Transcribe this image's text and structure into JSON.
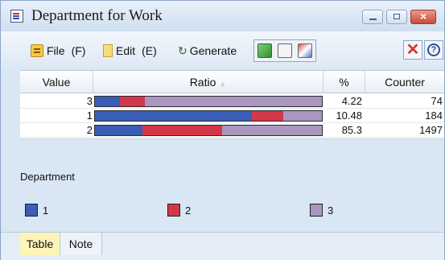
{
  "window": {
    "title": "Department for Work"
  },
  "toolbar": {
    "file_label": "File",
    "file_accel": "(F)",
    "edit_label": "Edit",
    "edit_accel": "(E)",
    "generate_label": "Generate"
  },
  "table": {
    "columns": [
      "Value",
      "Ratio",
      "%",
      "Counter"
    ],
    "rows": [
      {
        "value": "3",
        "percent": "4.22",
        "counter": "74",
        "segments": [
          {
            "color": "#3a5eb7",
            "share": 0.11
          },
          {
            "color": "#d2384a",
            "share": 0.11
          },
          {
            "color": "#a997bf",
            "share": 0.78
          }
        ]
      },
      {
        "value": "1",
        "percent": "10.48",
        "counter": "184",
        "segments": [
          {
            "color": "#3a5eb7",
            "share": 0.69
          },
          {
            "color": "#d2384a",
            "share": 0.14
          },
          {
            "color": "#a997bf",
            "share": 0.17
          }
        ]
      },
      {
        "value": "2",
        "percent": "85.3",
        "counter": "1497",
        "segments": [
          {
            "color": "#3a5eb7",
            "share": 0.21
          },
          {
            "color": "#d2384a",
            "share": 0.35
          },
          {
            "color": "#a997bf",
            "share": 0.44
          }
        ]
      }
    ]
  },
  "legend": {
    "title": "Department",
    "items": [
      {
        "label": "1",
        "color": "#3a5eb7"
      },
      {
        "label": "2",
        "color": "#d2384a"
      },
      {
        "label": "3",
        "color": "#a997bf"
      }
    ]
  },
  "tabs": [
    {
      "label": "Table",
      "active": true
    },
    {
      "label": "Note",
      "active": false
    }
  ]
}
